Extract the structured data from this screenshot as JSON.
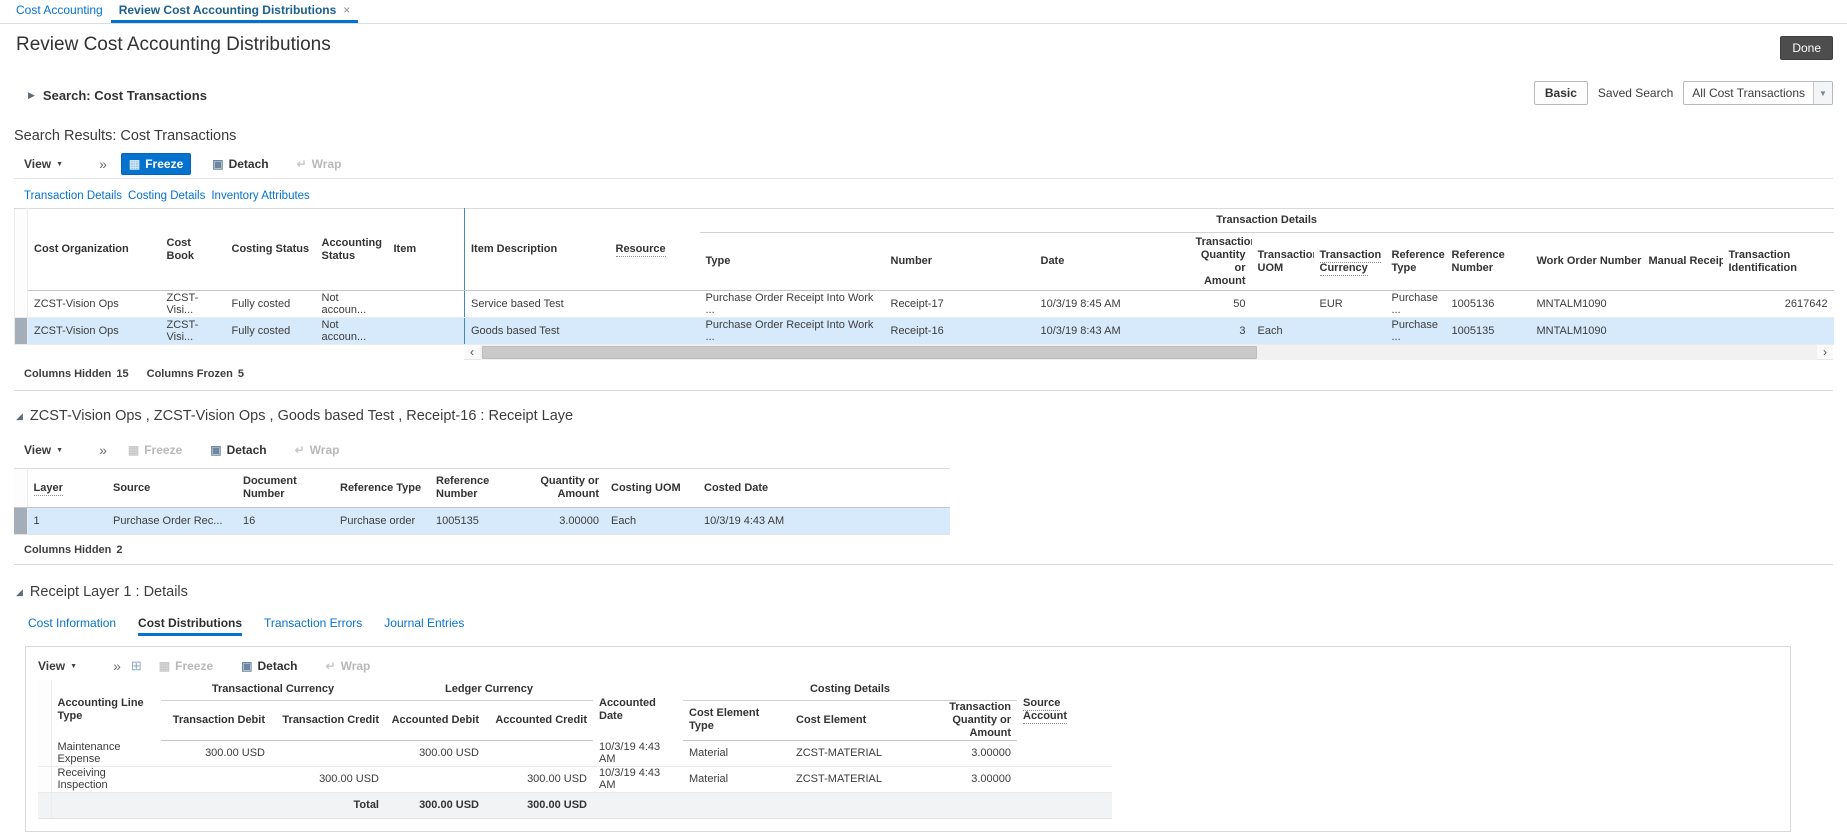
{
  "icons": {
    "collapsed": "▶",
    "expanded": "◢",
    "menu_arrow": "▼",
    "overflow": "»",
    "close": "×",
    "freeze": "▦",
    "detach": "▣",
    "wrap": "↵",
    "export": "⊞",
    "scroll_left": "‹",
    "scroll_right": "›",
    "select_arrow": "▼"
  },
  "colors": {
    "accent": "#0572ce",
    "selected_row": "#d7eafc",
    "done_button": "#4d4d4d"
  },
  "tabbar": {
    "tab_cost_accounting": "Cost Accounting",
    "tab_review": "Review Cost Accounting Distributions"
  },
  "page": {
    "title": "Review Cost Accounting Distributions",
    "done": "Done"
  },
  "search": {
    "title": "Search: Cost Transactions",
    "basic": "Basic",
    "saved_search": "Saved Search",
    "saved_search_value": "All Cost Transactions"
  },
  "toolbar": {
    "view": "View",
    "freeze": "Freeze",
    "detach": "Detach",
    "wrap": "Wrap"
  },
  "results": {
    "title": "Search Results: Cost Transactions",
    "links": {
      "transaction_details": "Transaction Details",
      "costing_details": "Costing Details",
      "inventory_attributes": "Inventory Attributes"
    },
    "table": {
      "group": "Transaction Details",
      "columns": {
        "cost_organization": "Cost Organization",
        "cost_book": "Cost Book",
        "costing_status": "Costing Status",
        "accounting_status": "Accounting Status",
        "item": "Item",
        "item_description": "Item Description",
        "resource": "Resource",
        "type": "Type",
        "number": "Number",
        "date": "Date",
        "txn_qty": "Transaction Quantity or Amount",
        "txn_uom": "Transaction UOM",
        "txn_currency": "Transaction Currency",
        "reference_type": "Reference Type",
        "reference_number": "Reference Number",
        "work_order_number": "Work Order Number",
        "manual_receipt": "Manual Receipt",
        "txn_identification": "Transaction Identification"
      },
      "rows": [
        {
          "cost_organization": "ZCST-Vision Ops",
          "cost_book": "ZCST-Visi...",
          "costing_status": "Fully costed",
          "accounting_status": "Not accoun...",
          "item": "",
          "item_description": "Service based Test",
          "resource": "",
          "type": "Purchase Order Receipt Into Work ...",
          "number": "Receipt-17",
          "date": "10/3/19 8:45 AM",
          "txn_qty": "50",
          "txn_uom": "",
          "txn_currency": "EUR",
          "reference_type": "Purchase ...",
          "reference_number": "1005136",
          "work_order_number": "MNTALM1090",
          "manual_receipt": "",
          "txn_identification": "2617642"
        },
        {
          "cost_organization": "ZCST-Vision Ops",
          "cost_book": "ZCST-Visi...",
          "costing_status": "Fully costed",
          "accounting_status": "Not accoun...",
          "item": "",
          "item_description": "Goods based Test",
          "resource": "",
          "type": "Purchase Order Receipt Into Work ...",
          "number": "Receipt-16",
          "date": "10/3/19 8:43 AM",
          "txn_qty": "3",
          "txn_uom": "Each",
          "txn_currency": "",
          "reference_type": "Purchase ...",
          "reference_number": "1005135",
          "work_order_number": "MNTALM1090",
          "manual_receipt": "",
          "txn_identification": ""
        }
      ],
      "footer": {
        "columns_hidden": "Columns Hidden",
        "columns_hidden_count": "15",
        "columns_frozen": "Columns Frozen",
        "columns_frozen_count": "5"
      }
    }
  },
  "layers": {
    "title": "ZCST-Vision Ops , ZCST-Vision Ops , Goods based Test , Receipt-16 : Receipt Laye",
    "table": {
      "columns": {
        "layer": "Layer",
        "source": "Source",
        "document_number": "Document Number",
        "reference_type": "Reference Type",
        "reference_number": "Reference Number",
        "quantity": "Quantity or Amount",
        "costing_uom": "Costing UOM",
        "costed_date": "Costed Date"
      },
      "rows": [
        {
          "layer": "1",
          "source": "Purchase Order Rec...",
          "document_number": "16",
          "reference_type": "Purchase order",
          "reference_number": "1005135",
          "quantity": "3.00000",
          "costing_uom": "Each",
          "costed_date": "10/3/19 4:43 AM"
        }
      ],
      "footer": {
        "columns_hidden": "Columns Hidden",
        "columns_hidden_count": "2"
      }
    }
  },
  "details": {
    "title": "Receipt Layer 1 : Details",
    "tabs": {
      "cost_information": "Cost Information",
      "cost_distributions": "Cost Distributions",
      "transaction_errors": "Transaction Errors",
      "journal_entries": "Journal Entries"
    },
    "table": {
      "groups": {
        "transactional_currency": "Transactional Currency",
        "ledger_currency": "Ledger Currency",
        "costing_details": "Costing Details"
      },
      "columns": {
        "line_type": "Accounting Line Type",
        "txn_debit": "Transaction Debit",
        "txn_credit": "Transaction Credit",
        "acc_debit": "Accounted Debit",
        "acc_credit": "Accounted Credit",
        "acc_date": "Accounted Date",
        "cost_element_type": "Cost Element Type",
        "cost_element": "Cost Element",
        "txn_qty": "Transaction Quantity or Amount",
        "source_account": "Source Account"
      },
      "rows": [
        {
          "line_type": "Maintenance Expense",
          "txn_debit": "300.00 USD",
          "txn_credit": "",
          "acc_debit": "300.00 USD",
          "acc_credit": "",
          "acc_date": "10/3/19 4:43 AM",
          "cost_element_type": "Material",
          "cost_element": "ZCST-MATERIAL",
          "txn_qty": "3.00000",
          "source_account": ""
        },
        {
          "line_type": "Receiving Inspection",
          "txn_debit": "",
          "txn_credit": "300.00 USD",
          "acc_debit": "",
          "acc_credit": "300.00 USD",
          "acc_date": "10/3/19 4:43 AM",
          "cost_element_type": "Material",
          "cost_element": "ZCST-MATERIAL",
          "txn_qty": "3.00000",
          "source_account": ""
        }
      ],
      "total": {
        "label": "Total",
        "acc_debit": "300.00 USD",
        "acc_credit": "300.00 USD"
      }
    }
  }
}
